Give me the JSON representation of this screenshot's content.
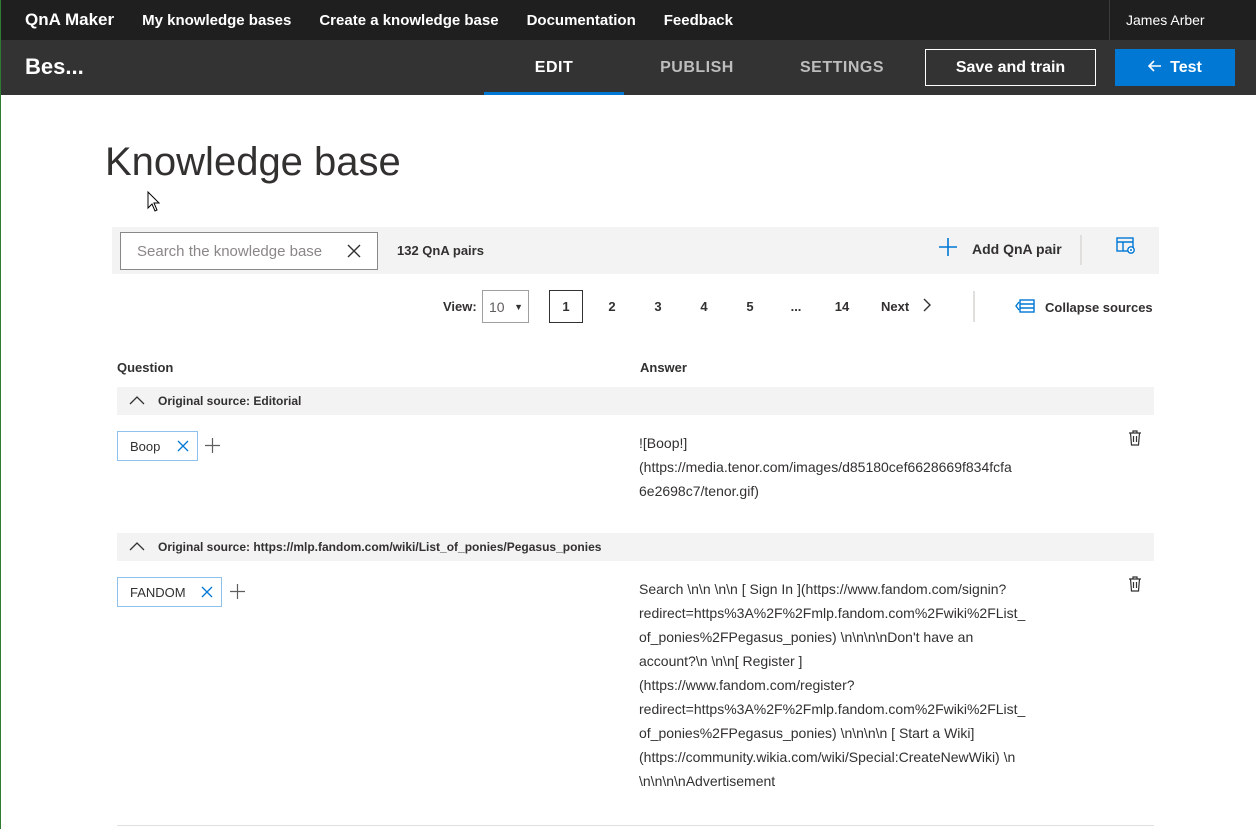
{
  "topnav": {
    "brand": "QnA Maker",
    "links": [
      "My knowledge bases",
      "Create a knowledge base",
      "Documentation",
      "Feedback"
    ],
    "user": "James Arber"
  },
  "subbar": {
    "kb_name": "Bes...",
    "tabs": [
      "EDIT",
      "PUBLISH",
      "SETTINGS"
    ],
    "active_tab": "EDIT",
    "save_label": "Save and train",
    "test_label": "Test",
    "accent_color": "#0078d4"
  },
  "page_title": "Knowledge base",
  "toolbar": {
    "search_placeholder": "Search the knowledge base",
    "search_value": "",
    "pair_count": "132 QnA pairs",
    "add_pair_label": "Add QnA pair"
  },
  "pager": {
    "view_label": "View:",
    "view_value": "10",
    "pages": [
      "1",
      "2",
      "3",
      "4",
      "5",
      "...",
      "14"
    ],
    "current_page": "1",
    "next_label": "Next",
    "collapse_label": "Collapse sources"
  },
  "table": {
    "question_header": "Question",
    "answer_header": "Answer",
    "groups": [
      {
        "source": "Original source: Editorial",
        "question": "Boop",
        "answer": "![Boop!]\n(https://media.tenor.com/images/d85180cef6628669f834fcfa\n6e2698c7/tenor.gif)"
      },
      {
        "source": "Original source: https://mlp.fandom.com/wiki/List_of_ponies/Pegasus_ponies",
        "question": "FANDOM",
        "answer": "Search \\n\\n \\n\\n [ Sign In ](https://www.fandom.com/signin?\nredirect=https%3A%2F%2Fmlp.fandom.com%2Fwiki%2FList_\nof_ponies%2FPegasus_ponies) \\n\\n\\n\\nDon't have an\naccount?\\n \\n\\n[ Register ]\n(https://www.fandom.com/register?\nredirect=https%3A%2F%2Fmlp.fandom.com%2Fwiki%2FList_\nof_ponies%2FPegasus_ponies) \\n\\n\\n\\n [ Start a Wiki]\n(https://community.wikia.com/wiki/Special:CreateNewWiki) \\n\n\\n\\n\\n\\nAdvertisement"
      }
    ]
  }
}
